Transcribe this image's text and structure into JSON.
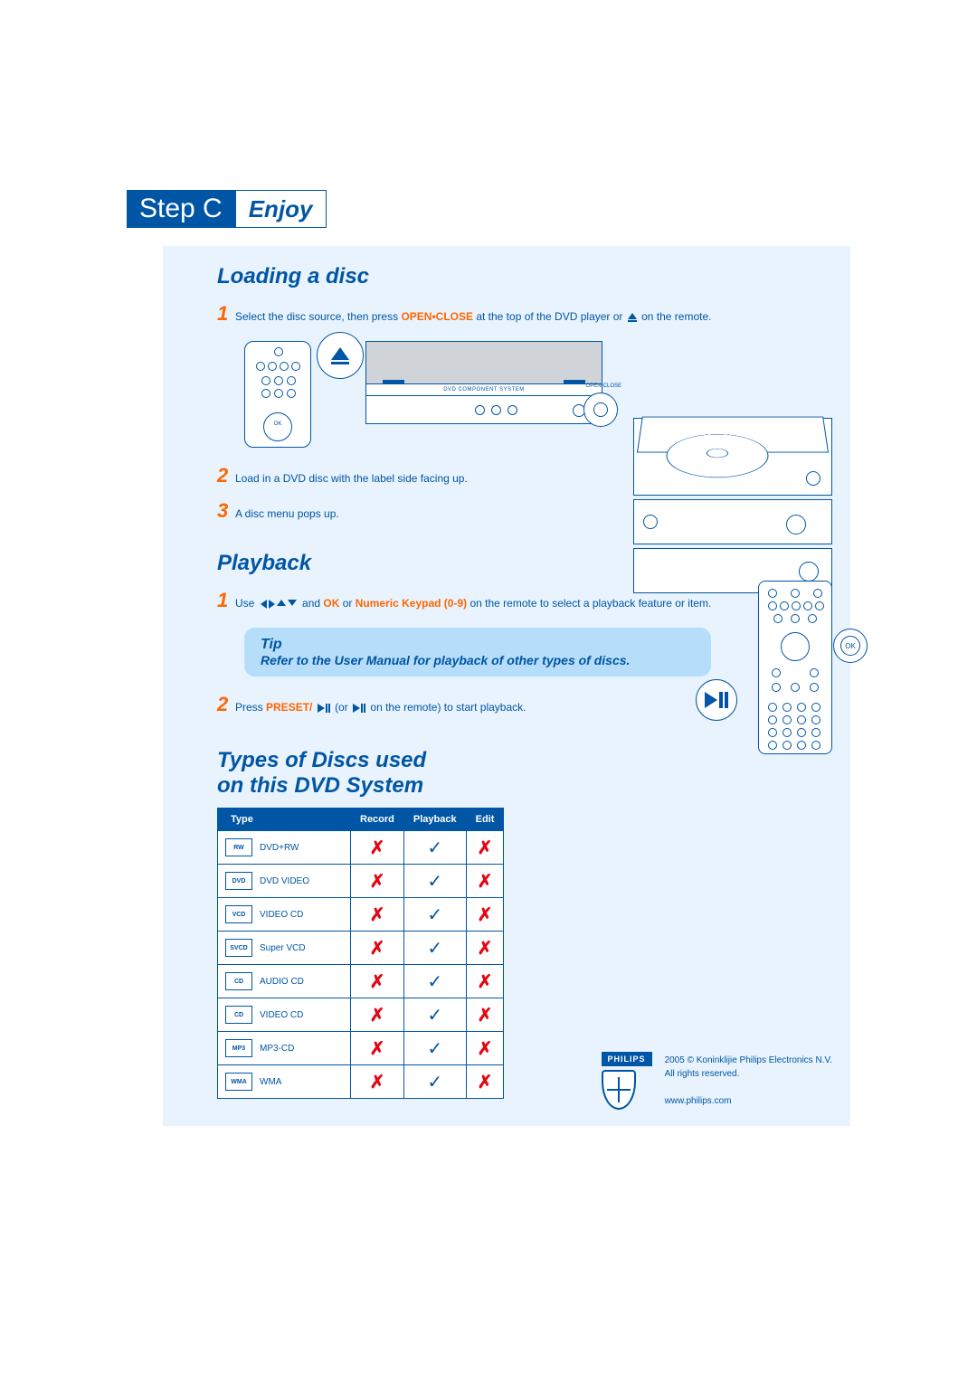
{
  "step": {
    "badge": "Step C",
    "label": "Enjoy"
  },
  "sections": {
    "loading": {
      "title": "Loading a disc",
      "s1_a": "Select the disc source, then press ",
      "s1_cmd": "OPEN•CLOSE",
      "s1_b": " at the top of the DVD player or ",
      "s1_c": " on the remote.",
      "s2": "Load in a DVD disc with the label side facing up.",
      "s3": "A disc menu pops up.",
      "dvd_label": "DVD COMPONENT SYSTEM",
      "open_close_label": "OPEN•CLOSE"
    },
    "playback": {
      "title": "Playback",
      "s1_a": "Use ",
      "s1_b": " and ",
      "s1_ok": "OK",
      "s1_c": " or ",
      "s1_keypad": "Numeric Keypad (0-9)",
      "s1_d": " on the remote to select a playback feature or item.",
      "tip_title": "Tip",
      "tip_text": "Refer to the User Manual for playback of other types of discs.",
      "s2_a": "Press ",
      "s2_cmd": "PRESET/",
      "s2_b": " (or ",
      "s2_c": " on the remote) to start playback.",
      "ok_callout": "OK"
    },
    "types": {
      "title_l1": "Types of Discs used",
      "title_l2": "on this DVD System",
      "headers": {
        "type": "Type",
        "record": "Record",
        "playback": "Playback",
        "edit": "Edit"
      },
      "rows": [
        {
          "logo": "RW",
          "label": "DVD+RW",
          "record": "x",
          "playback": "v",
          "edit": "x"
        },
        {
          "logo": "DVD",
          "label": "DVD VIDEO",
          "record": "x",
          "playback": "v",
          "edit": "x"
        },
        {
          "logo": "VCD",
          "label": "VIDEO CD",
          "record": "x",
          "playback": "v",
          "edit": "x"
        },
        {
          "logo": "SVCD",
          "label": "Super VCD",
          "record": "x",
          "playback": "v",
          "edit": "x"
        },
        {
          "logo": "CD",
          "label": "AUDIO CD",
          "record": "x",
          "playback": "v",
          "edit": "x"
        },
        {
          "logo": "CD",
          "label": "VIDEO CD",
          "record": "x",
          "playback": "v",
          "edit": "x"
        },
        {
          "logo": "MP3",
          "label": "MP3-CD",
          "record": "x",
          "playback": "v",
          "edit": "x"
        },
        {
          "logo": "WMA",
          "label": "WMA",
          "record": "x",
          "playback": "v",
          "edit": "x"
        }
      ]
    }
  },
  "footer": {
    "brand": "PHILIPS",
    "copyright": "2005 © Koninklijie Philips Electronics N.V.",
    "rights": "All rights reserved.",
    "url": "www.philips.com"
  },
  "numbers": {
    "n1": "1",
    "n2": "2",
    "n3": "3"
  }
}
